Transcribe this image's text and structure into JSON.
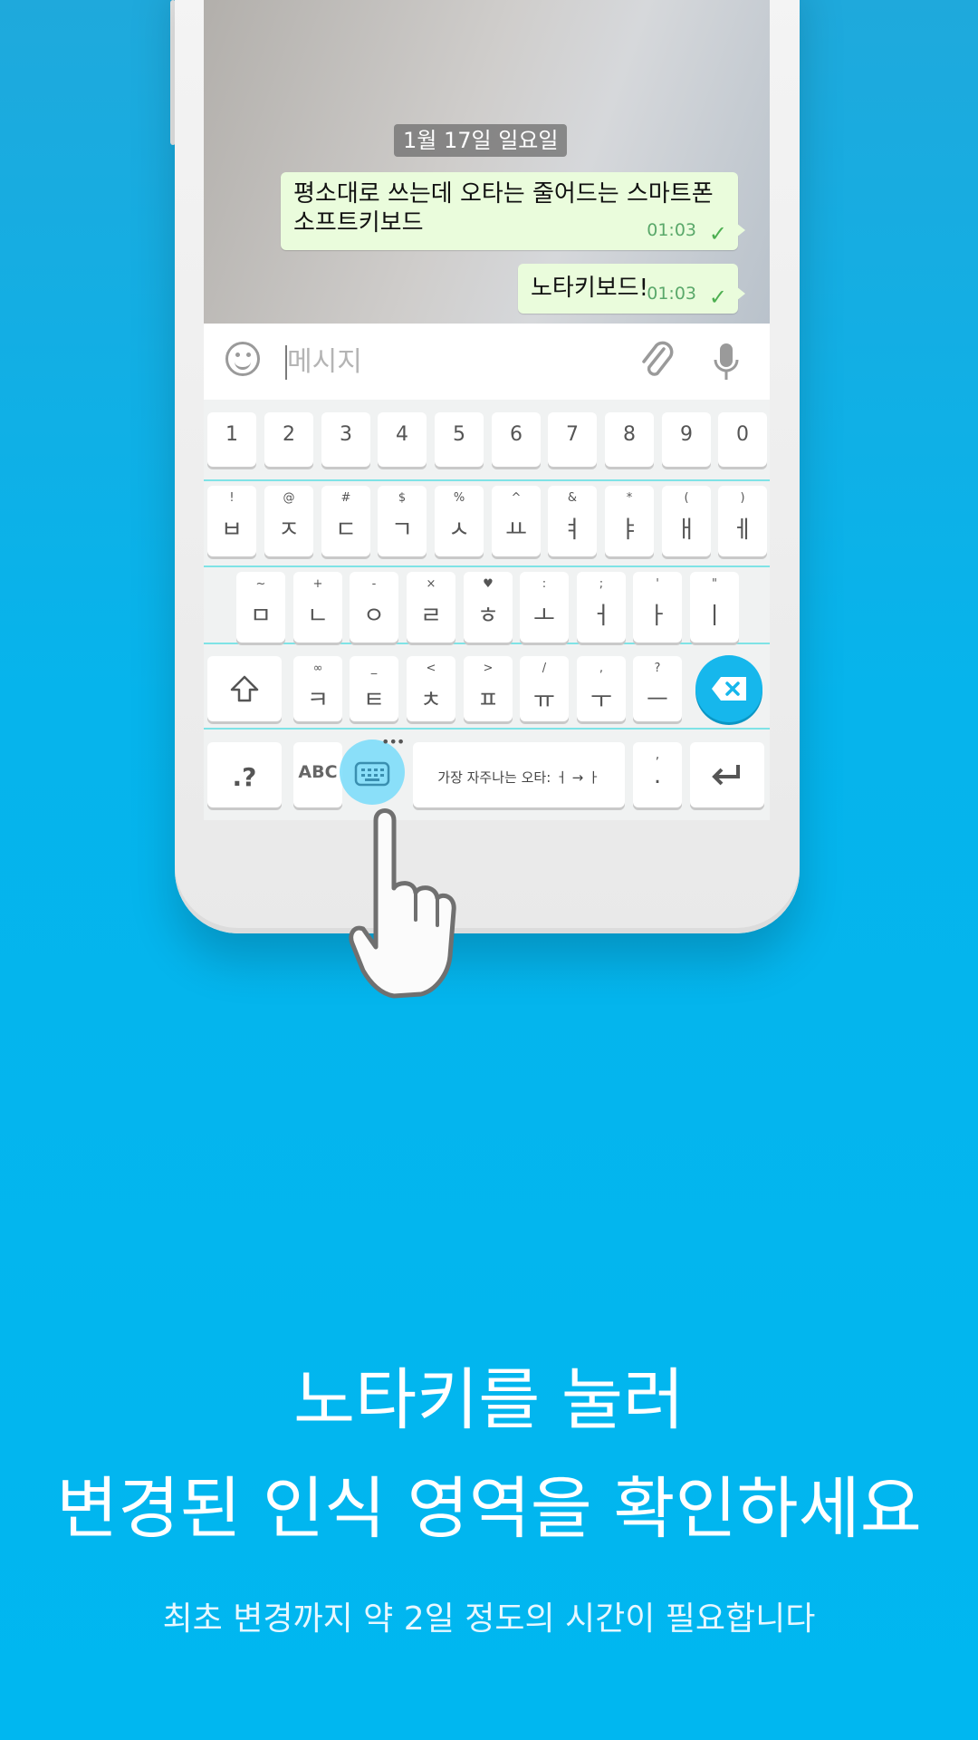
{
  "chat": {
    "date": "1월 17일 일요일",
    "messages": [
      {
        "line1": "평소대로 쓰는데 오타는 줄어드는 스마트폰",
        "line2": "소프트키보드",
        "time": "01:03",
        "check": "✓"
      },
      {
        "line1": "노타키보드!",
        "time": "01:03",
        "check": "✓"
      }
    ]
  },
  "input": {
    "placeholder": "메시지"
  },
  "keyboard": {
    "numbers": [
      "1",
      "2",
      "3",
      "4",
      "5",
      "6",
      "7",
      "8",
      "9",
      "0"
    ],
    "row2": [
      {
        "main": "ㅂ",
        "sup": "!"
      },
      {
        "main": "ㅈ",
        "sup": "@"
      },
      {
        "main": "ㄷ",
        "sup": "#"
      },
      {
        "main": "ㄱ",
        "sup": "$"
      },
      {
        "main": "ㅅ",
        "sup": "%"
      },
      {
        "main": "ㅛ",
        "sup": "^"
      },
      {
        "main": "ㅕ",
        "sup": "&"
      },
      {
        "main": "ㅑ",
        "sup": "*"
      },
      {
        "main": "ㅐ",
        "sup": "("
      },
      {
        "main": "ㅔ",
        "sup": ")"
      }
    ],
    "row3": [
      {
        "main": "ㅁ",
        "sup": "~"
      },
      {
        "main": "ㄴ",
        "sup": "+"
      },
      {
        "main": "ㅇ",
        "sup": "-"
      },
      {
        "main": "ㄹ",
        "sup": "×"
      },
      {
        "main": "ㅎ",
        "sup": "♥"
      },
      {
        "main": "ㅗ",
        "sup": ":"
      },
      {
        "main": "ㅓ",
        "sup": ";"
      },
      {
        "main": "ㅏ",
        "sup": "'"
      },
      {
        "main": "ㅣ",
        "sup": "\""
      }
    ],
    "row4": [
      {
        "main": "ㅋ",
        "sup": "∞"
      },
      {
        "main": "ㅌ",
        "sup": "_"
      },
      {
        "main": "ㅊ",
        "sup": "<"
      },
      {
        "main": "ㅍ",
        "sup": ">"
      },
      {
        "main": "ㅠ",
        "sup": "/"
      },
      {
        "main": "ㅜ",
        "sup": ","
      },
      {
        "main": "ㅡ",
        "sup": "?"
      }
    ],
    "symbols_label": ".?",
    "abc_label": "ABC",
    "dots": "•••",
    "space_label": "가장 자주나는 오타: ㅓ → ㅏ",
    "period_label": ".",
    "period_sup": ","
  },
  "promo": {
    "line1": "노타키를 눌러",
    "line2": "변경된 인식 영역을 확인하세요",
    "sub": "최초 변경까지 약 2일 정도의 시간이 필요합니다"
  }
}
